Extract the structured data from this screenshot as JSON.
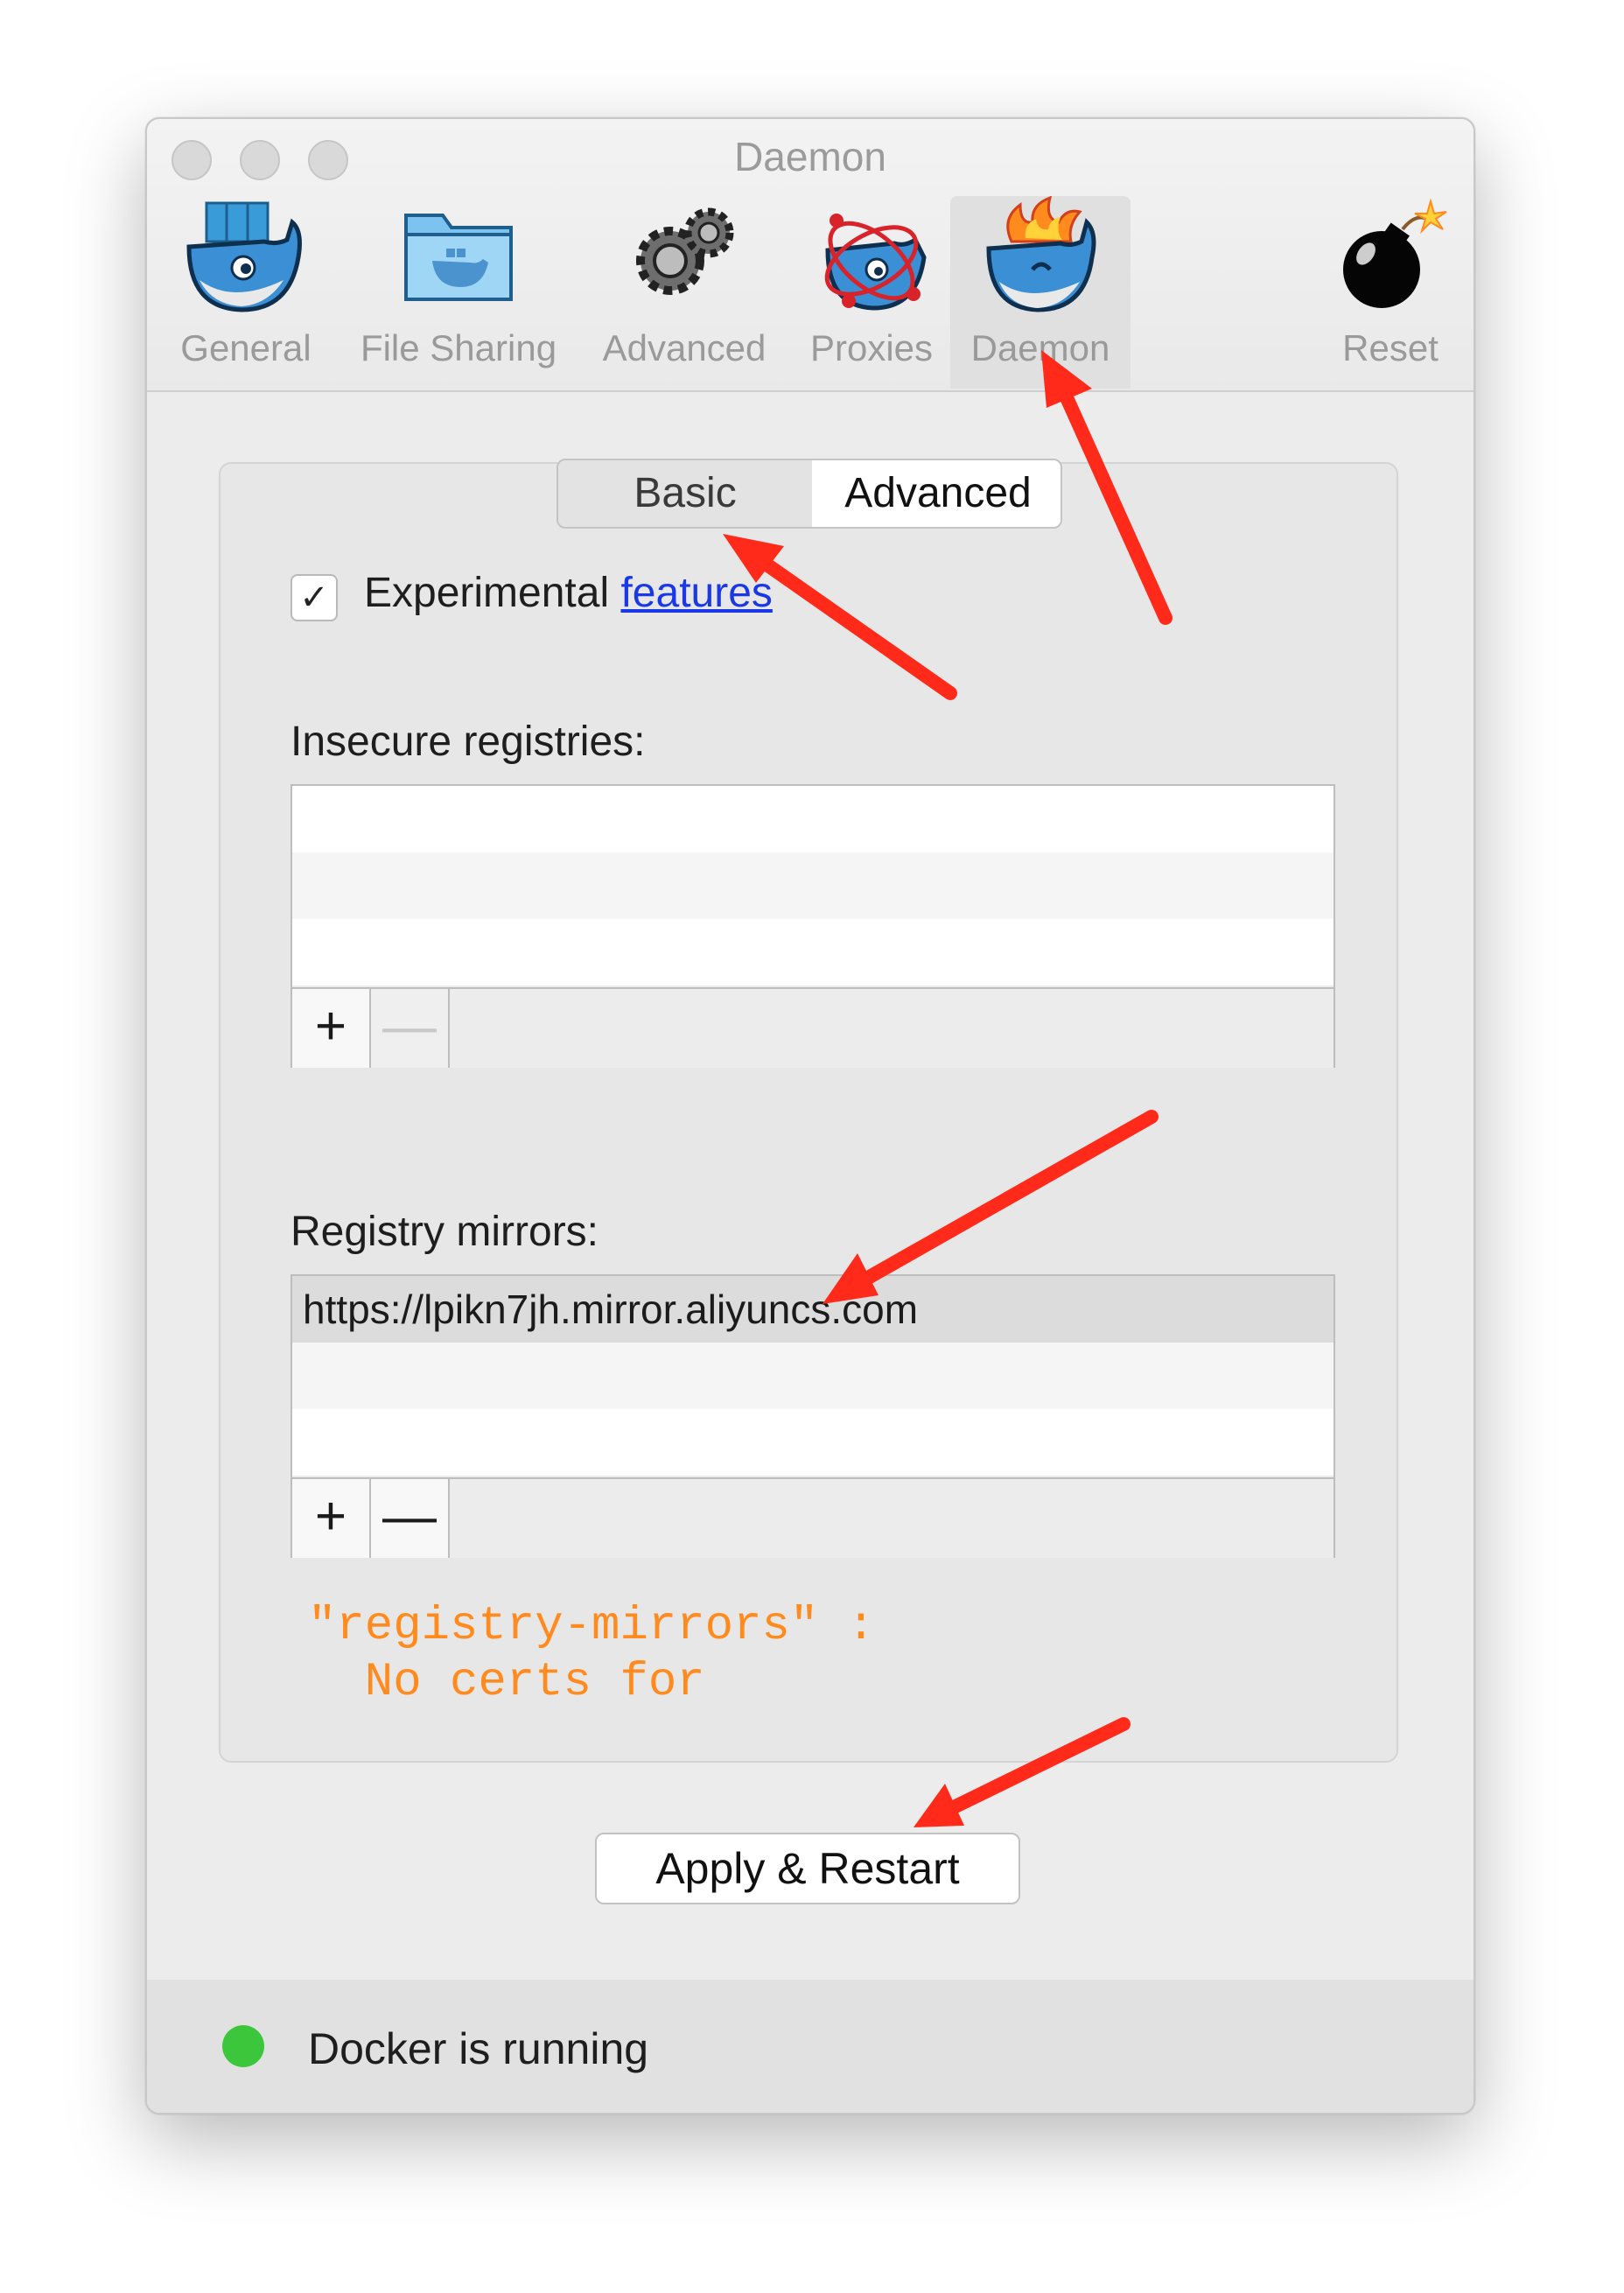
{
  "window": {
    "title": "Daemon"
  },
  "tabs": [
    {
      "label": "General",
      "icon": "docker-whale-icon"
    },
    {
      "label": "File Sharing",
      "icon": "folder-whale-icon"
    },
    {
      "label": "Advanced",
      "icon": "gears-icon"
    },
    {
      "label": "Proxies",
      "icon": "proxy-whale-icon"
    },
    {
      "label": "Daemon",
      "icon": "fire-whale-icon",
      "selected": true
    },
    {
      "label": "Reset",
      "icon": "bomb-icon"
    }
  ],
  "segmented": {
    "basic": "Basic",
    "advanced": "Advanced",
    "selected": "Advanced"
  },
  "experimental": {
    "checked_glyph": "✓",
    "label": "Experimental",
    "link": "features"
  },
  "insecure": {
    "label": "Insecure registries:",
    "add": "+",
    "remove": "—"
  },
  "mirrors": {
    "label": "Registry mirrors:",
    "entries": [
      "https://lpikn7jh.mirror.aliyuncs.com"
    ],
    "add": "+",
    "remove": "—"
  },
  "error": {
    "line1": "\"registry-mirrors\" :",
    "line2": "  No certs for"
  },
  "apply_label": "Apply & Restart",
  "status": {
    "text": "Docker is running",
    "color": "#3cc63c"
  },
  "annotation_color": "#ff2a1a"
}
